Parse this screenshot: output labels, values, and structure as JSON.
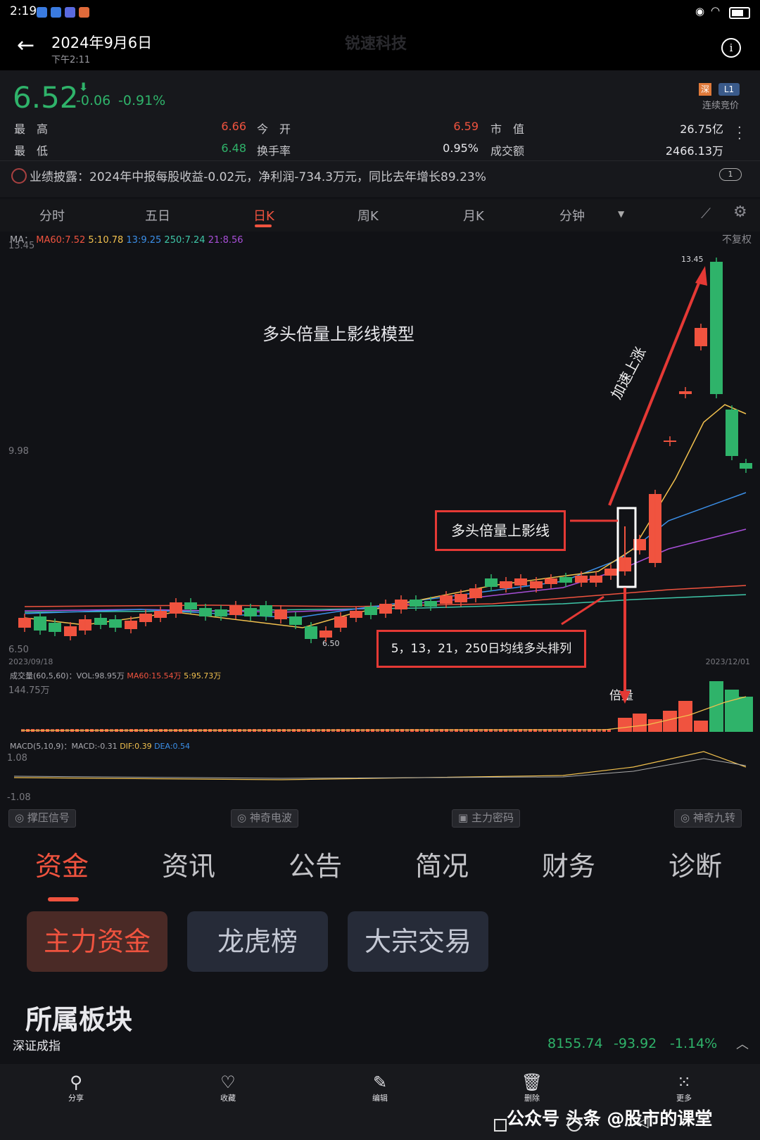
{
  "status": {
    "time": "2:19"
  },
  "header": {
    "date": "2024年9月6日",
    "time": "下午2:11",
    "stock_name": "锐速科技"
  },
  "quote": {
    "price": "6.52",
    "change": "-0.06",
    "change_pct": "-0.91%",
    "badge_market": "深",
    "badge_level": "L1",
    "mode": "连续竞价",
    "rows": [
      {
        "l1": "最　高",
        "v1": "6.66",
        "l2": "今　开",
        "v2": "6.59",
        "l3": "市　值",
        "v3": "26.75亿"
      },
      {
        "l1": "最　低",
        "v1": "6.48",
        "l2": "换手率",
        "v2": "0.95%",
        "l3": "成交额",
        "v3": "2466.13万"
      }
    ],
    "news": "业绩披露：2024年中报每股收益-0.02元，净利润-734.3万元，同比去年增长89.23%",
    "news_badge": "1"
  },
  "tabs": [
    "分时",
    "五日",
    "日K",
    "周K",
    "月K",
    "分钟"
  ],
  "active_tab": "日K",
  "chart": {
    "ma_prefix": "MA：",
    "ma_items": [
      {
        "text": "MA60:7.52",
        "color": "#f0533f"
      },
      {
        "text": "5:10.78",
        "color": "#f2c14e"
      },
      {
        "text": "13:9.25",
        "color": "#3b8fe8"
      },
      {
        "text": "250:7.24",
        "color": "#3ec6a8"
      },
      {
        "text": "21:8.56",
        "color": "#a84fd8"
      }
    ],
    "adjust": "不复权",
    "y_top": "13.45",
    "y_mid": "9.98",
    "y_bottom": "6.50",
    "date_start": "2023/09/18",
    "date_end": "2023/12/01",
    "high_label": "13.45",
    "low_label": "6.50",
    "title": "多头倍量上影线模型",
    "box_label": "多头倍量上影线",
    "ma_label": "5，13，21，250日均线多头排列",
    "rally_label": "加速上涨",
    "vol_label": "倍量",
    "vol_header": "成交量(60,5,60)：VOL:98.95万",
    "vol_ma60": "MA60:15.54万",
    "vol_ma5": "5:95.73万",
    "vol_max": "144.75万",
    "macd_header": "MACD(5,10,9)：MACD:-0.31",
    "macd_dif": "DIF:0.39",
    "macd_dea": "DEA:0.54",
    "macd_top": "1.08",
    "macd_bottom": "-1.08"
  },
  "signals": [
    "撑压信号",
    "神奇电波",
    "主力密码",
    "神奇九转"
  ],
  "main_tabs": [
    "资金",
    "资讯",
    "公告",
    "简况",
    "财务",
    "诊断"
  ],
  "sub_tabs": [
    "主力资金",
    "龙虎榜",
    "大宗交易"
  ],
  "section_title": "所属板块",
  "index": {
    "name": "深证成指",
    "value": "8155.74",
    "change": "-93.92",
    "pct": "-1.14%"
  },
  "bottom_bar": [
    "分享",
    "收藏",
    "编辑",
    "删除",
    "更多"
  ],
  "watermark": "公众号  头条 @股市的课堂",
  "colors": {
    "up": "#f0533f",
    "down": "#2fb36a",
    "bg": "#111216",
    "annotation": "#e53935"
  }
}
